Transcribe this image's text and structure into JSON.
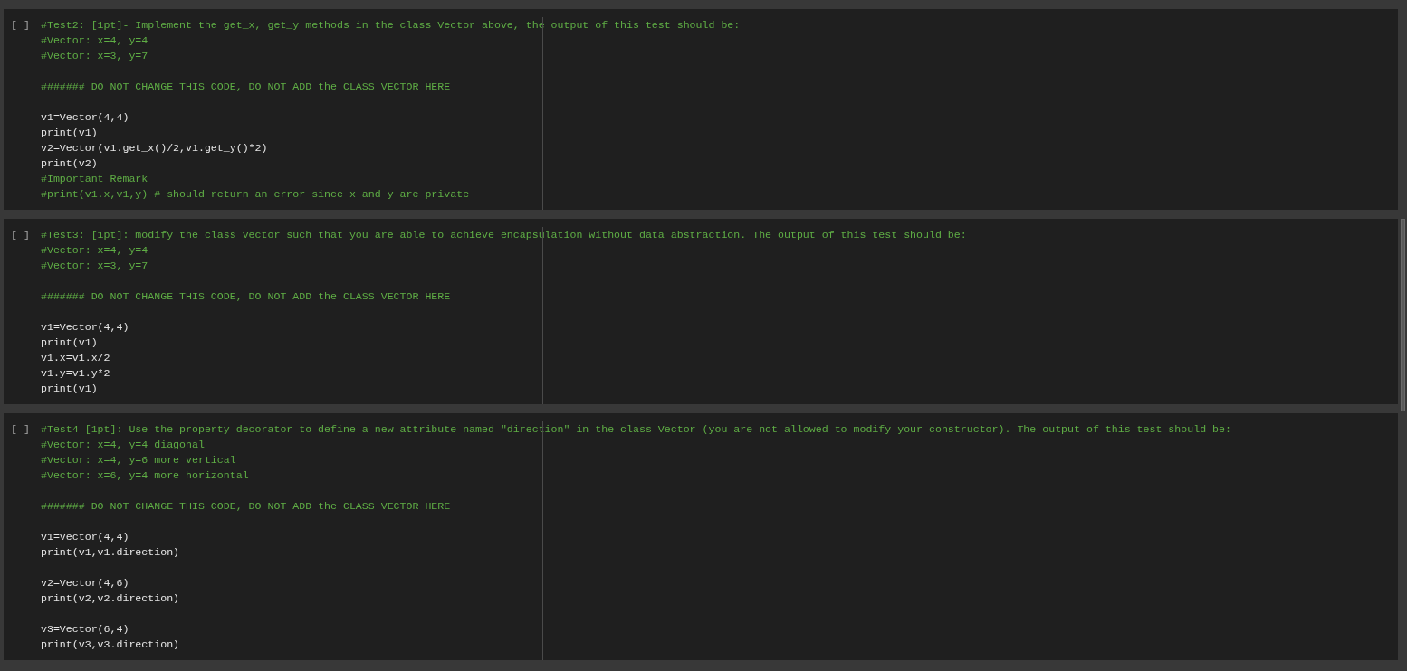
{
  "cells": [
    {
      "prompt": "[ ]",
      "lines": [
        {
          "kind": "comment",
          "text": "#Test2: [1pt]- Implement the get_x, get_y methods in the class Vector above, the output of this test should be:"
        },
        {
          "kind": "comment",
          "text": "#Vector: x=4, y=4"
        },
        {
          "kind": "comment",
          "text": "#Vector: x=3, y=7"
        },
        {
          "kind": "blank"
        },
        {
          "kind": "comment",
          "text": "####### DO NOT CHANGE THIS CODE, DO NOT ADD the CLASS VECTOR HERE"
        },
        {
          "kind": "blank"
        },
        {
          "kind": "code",
          "text": "v1=Vector(4,4)"
        },
        {
          "kind": "code",
          "text": "print(v1)"
        },
        {
          "kind": "code",
          "text": "v2=Vector(v1.get_x()/2,v1.get_y()*2)"
        },
        {
          "kind": "code",
          "text": "print(v2)"
        },
        {
          "kind": "comment",
          "text": "#Important Remark"
        },
        {
          "kind": "comment",
          "text": "#print(v1.x,v1,y) # should return an error since x and y are private"
        }
      ]
    },
    {
      "prompt": "[ ]",
      "lines": [
        {
          "kind": "comment",
          "text": "#Test3: [1pt]: modify the class Vector such that you are able to achieve encapsulation without data abstraction. The output of this test should be:"
        },
        {
          "kind": "comment",
          "text": "#Vector: x=4, y=4"
        },
        {
          "kind": "comment",
          "text": "#Vector: x=3, y=7"
        },
        {
          "kind": "blank"
        },
        {
          "kind": "comment",
          "text": "####### DO NOT CHANGE THIS CODE, DO NOT ADD the CLASS VECTOR HERE"
        },
        {
          "kind": "blank"
        },
        {
          "kind": "code",
          "text": "v1=Vector(4,4)"
        },
        {
          "kind": "code",
          "text": "print(v1)"
        },
        {
          "kind": "code",
          "text": "v1.x=v1.x/2"
        },
        {
          "kind": "code",
          "text": "v1.y=v1.y*2"
        },
        {
          "kind": "code",
          "text": "print(v1)"
        }
      ]
    },
    {
      "prompt": "[ ]",
      "lines": [
        {
          "kind": "comment",
          "text": "#Test4 [1pt]: Use the property decorator to define a new attribute named \"direction\" in the class Vector (you are not allowed to modify your constructor). The output of this test should be:"
        },
        {
          "kind": "comment",
          "text": "#Vector: x=4, y=4 diagonal"
        },
        {
          "kind": "comment",
          "text": "#Vector: x=4, y=6 more vertical"
        },
        {
          "kind": "comment",
          "text": "#Vector: x=6, y=4 more horizontal"
        },
        {
          "kind": "blank"
        },
        {
          "kind": "comment",
          "text": "####### DO NOT CHANGE THIS CODE, DO NOT ADD the CLASS VECTOR HERE"
        },
        {
          "kind": "blank"
        },
        {
          "kind": "code",
          "text": "v1=Vector(4,4)"
        },
        {
          "kind": "code",
          "text": "print(v1,v1.direction)"
        },
        {
          "kind": "blank"
        },
        {
          "kind": "code",
          "text": "v2=Vector(4,6)"
        },
        {
          "kind": "code",
          "text": "print(v2,v2.direction)"
        },
        {
          "kind": "blank"
        },
        {
          "kind": "code",
          "text": "v3=Vector(6,4)"
        },
        {
          "kind": "code",
          "text": "print(v3,v3.direction)"
        }
      ]
    }
  ]
}
